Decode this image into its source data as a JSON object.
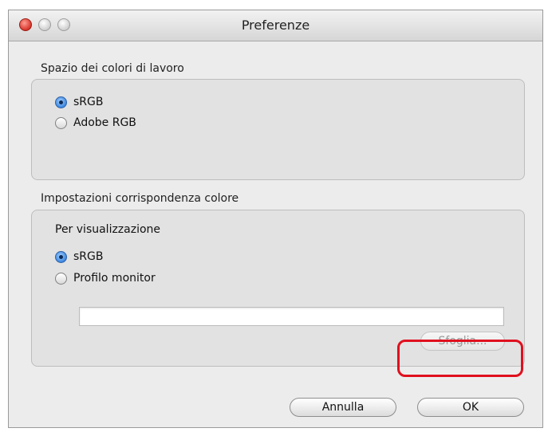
{
  "window": {
    "title": "Preferenze"
  },
  "working_space": {
    "title": "Spazio dei colori di lavoro",
    "options": [
      {
        "label": "sRGB",
        "selected": true
      },
      {
        "label": "Adobe RGB",
        "selected": false
      }
    ]
  },
  "color_matching": {
    "title": "Impostazioni corrispondenza colore",
    "subtitle": "Per visualizzazione",
    "options": [
      {
        "label": "sRGB",
        "selected": true
      },
      {
        "label": "Profilo monitor",
        "selected": false
      }
    ],
    "profile_path": "",
    "browse_label": "Sfoglia..."
  },
  "buttons": {
    "cancel_label": "Annulla",
    "ok_label": "OK"
  },
  "colors": {
    "highlight": "#e0101e",
    "radio_selected": "#3b86e0"
  }
}
